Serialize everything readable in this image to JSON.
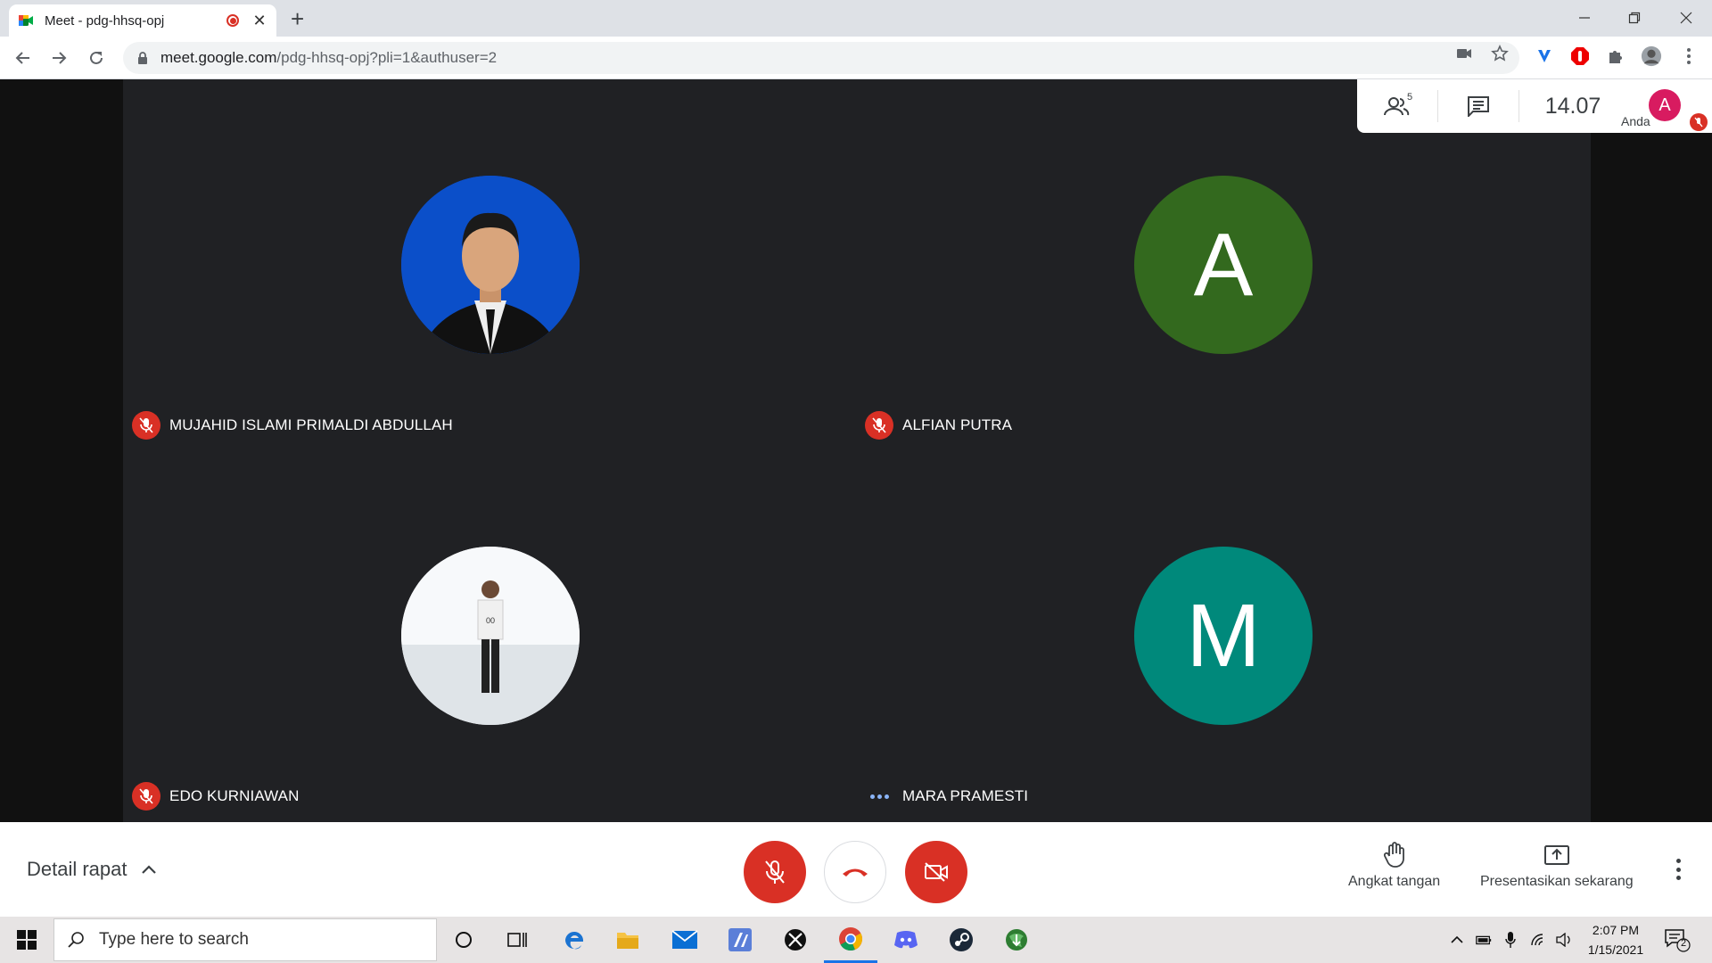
{
  "browser": {
    "tab_title": "Meet - pdg-hhsq-opj",
    "url_host": "meet.google.com",
    "url_path": "/pdg-hhsq-opj?pli=1&authuser=2"
  },
  "meet": {
    "participant_count": "5",
    "time": "14.07",
    "self_initial": "A",
    "self_label": "Anda",
    "participants": [
      {
        "name": "MUJAHID ISLAMI PRIMALDI ABDULLAH",
        "status": "muted",
        "avatar": "photo-blue",
        "initial": ""
      },
      {
        "name": "ALFIAN PUTRA",
        "status": "muted",
        "avatar": "initial",
        "initial": "A",
        "color": "#33691e"
      },
      {
        "name": "EDO KURNIAWAN",
        "status": "muted",
        "avatar": "photo-white",
        "initial": ""
      },
      {
        "name": "MARA PRAMESTI",
        "status": "speaking-dots",
        "avatar": "initial",
        "initial": "M",
        "color": "#00897b"
      }
    ]
  },
  "controls": {
    "details_label": "Detail rapat",
    "raise_hand_label": "Angkat tangan",
    "present_label": "Presentasikan sekarang"
  },
  "taskbar": {
    "search_placeholder": "Type here to search",
    "time": "2:07 PM",
    "date": "1/15/2021",
    "notification_count": "2"
  },
  "colors": {
    "danger": "#d93025",
    "meet_bg": "#202124",
    "alfian_avatar": "#33691e",
    "mara_avatar": "#00897b"
  }
}
